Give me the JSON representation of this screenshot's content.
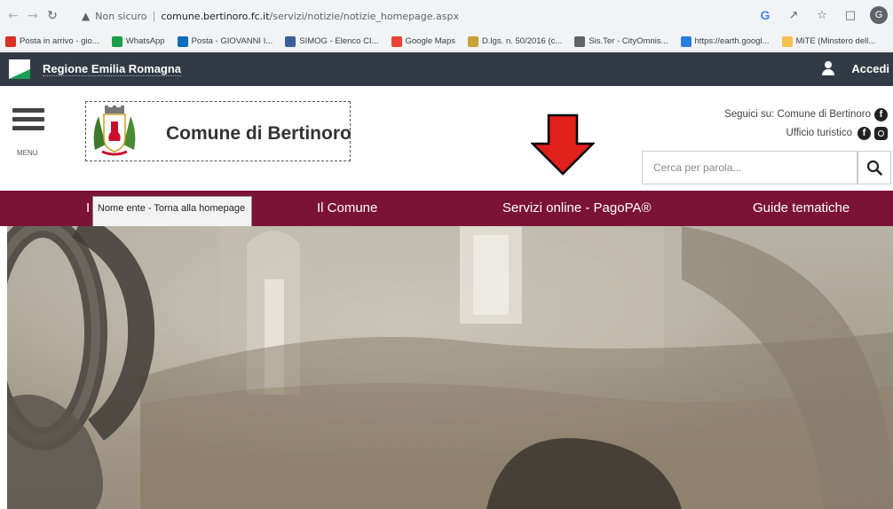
{
  "browser": {
    "security_label": "Non sicuro",
    "url_host": "comune.bertinoro.fc.it",
    "url_path": "/servizi/notizie/notizie_homepage.aspx",
    "avatar_initial": "G"
  },
  "bookmarks": [
    {
      "label": "Posta in arrivo - gio...",
      "icon": "gmail-icon",
      "color": "#d93025"
    },
    {
      "label": "WhatsApp",
      "icon": "whatsapp-icon",
      "color": "#1b9f48"
    },
    {
      "label": "Posta - GIOVANNI I...",
      "icon": "outlook-icon",
      "color": "#0f6cbd"
    },
    {
      "label": "SIMOG - Elenco CI...",
      "icon": "simog-icon",
      "color": "#3a5f9b"
    },
    {
      "label": "Google Maps",
      "icon": "maps-icon",
      "color": "#ea4335"
    },
    {
      "label": "D.lgs. n. 50/2016 (c...",
      "icon": "doc-icon",
      "color": "#c8a03a"
    },
    {
      "label": "Sis.Ter - CityOmnis...",
      "icon": "globe-icon",
      "color": "#5f6368"
    },
    {
      "label": "https://earth.googl...",
      "icon": "earth-icon",
      "color": "#2a7ee0"
    },
    {
      "label": "MiTE (Minstero dell...",
      "icon": "folder-icon",
      "color": "#f2c14e"
    }
  ],
  "regione": {
    "name": "Regione Emilia Romagna",
    "login_label": "Accedi"
  },
  "header": {
    "menu_label": "MENU",
    "site_name": "Comune di Bertinoro",
    "social_follow": "Seguici su: Comune di Bertinoro",
    "tourist_office": "Ufficio turistico",
    "search_placeholder": "Cerca per parola..."
  },
  "nav": {
    "items": [
      "Il Comune",
      "Servizi online - PagoPA®",
      "Guide tematiche"
    ],
    "hidden_first_letter": "I"
  },
  "tooltip": {
    "text": "Nome ente - Torna alla homepage"
  },
  "colors": {
    "nav_bg": "#7b1336",
    "regione_bar": "#323a45",
    "arrow": "#e0201b"
  }
}
